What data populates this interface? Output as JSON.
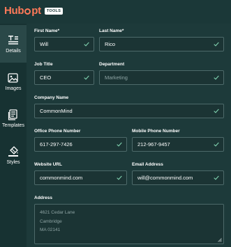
{
  "brand": {
    "name_part1": "Hub",
    "name_part2": "pt",
    "badge": "TOOLS",
    "accent": "#ff7a59"
  },
  "sidebar": {
    "items": [
      {
        "label": "Details",
        "icon": "text-lines-icon",
        "active": true
      },
      {
        "label": "Images",
        "icon": "image-icon",
        "active": false
      },
      {
        "label": "Templates",
        "icon": "templates-icon",
        "active": false
      },
      {
        "label": "Styles",
        "icon": "paint-bucket-icon",
        "active": false
      }
    ]
  },
  "form": {
    "first_name": {
      "label": "First Name*",
      "value": "Will"
    },
    "last_name": {
      "label": "Last Name*",
      "value": "Rico"
    },
    "job_title": {
      "label": "Job Title",
      "value": "CEO"
    },
    "department": {
      "label": "Department",
      "placeholder": "Marketing"
    },
    "company_name": {
      "label": "Company Name",
      "value": "CommonMind"
    },
    "office_phone": {
      "label": "Office Phone Number",
      "value": "617-297-7426"
    },
    "mobile_phone": {
      "label": "Mobile Phone Number",
      "value": "212-967-9457"
    },
    "website": {
      "label": "Website URL",
      "value": "commonmind.com"
    },
    "email": {
      "label": "Email Address",
      "value": "will@commonmind.com"
    },
    "address": {
      "label": "Address",
      "placeholder_lines": [
        "4621 Cedar Lane",
        "Cambridge",
        "MA 02141"
      ]
    }
  },
  "colors": {
    "valid_check": "#7fd1ae"
  }
}
